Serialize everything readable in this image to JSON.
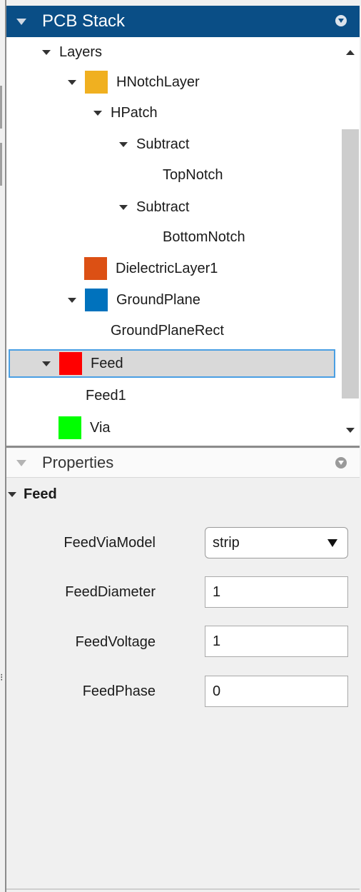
{
  "stack_panel": {
    "title": "PCB Stack",
    "tree": [
      {
        "label": "Layers",
        "expander": true,
        "swatch": null
      },
      {
        "label": "HNotchLayer",
        "expander": true,
        "swatch": "#f0b020"
      },
      {
        "label": "HPatch",
        "expander": true,
        "swatch": null
      },
      {
        "label": "Subtract",
        "expander": true,
        "swatch": null
      },
      {
        "label": "TopNotch",
        "expander": false,
        "swatch": null
      },
      {
        "label": "Subtract",
        "expander": true,
        "swatch": null
      },
      {
        "label": "BottomNotch",
        "expander": false,
        "swatch": null
      },
      {
        "label": "DielectricLayer1",
        "expander": false,
        "swatch": "#dc5014"
      },
      {
        "label": "GroundPlane",
        "expander": true,
        "swatch": "#0072bd"
      },
      {
        "label": "GroundPlaneRect",
        "expander": false,
        "swatch": null
      },
      {
        "label": "Feed",
        "expander": true,
        "swatch": "#ff0000",
        "selected": true
      },
      {
        "label": "Feed1",
        "expander": false,
        "swatch": null
      },
      {
        "label": "Via",
        "expander": false,
        "swatch": "#00ff00"
      }
    ]
  },
  "properties_panel": {
    "title": "Properties",
    "group": "Feed",
    "fields": {
      "via_model": {
        "label": "FeedViaModel",
        "value": "strip"
      },
      "diameter": {
        "label": "FeedDiameter",
        "value": "1"
      },
      "voltage": {
        "label": "FeedVoltage",
        "value": "1"
      },
      "phase": {
        "label": "FeedPhase",
        "value": "0"
      }
    }
  },
  "colors": {
    "header_blue": "#0a4e86",
    "selection_border": "#4a9fe3",
    "selection_fill": "#d9d9d9"
  }
}
